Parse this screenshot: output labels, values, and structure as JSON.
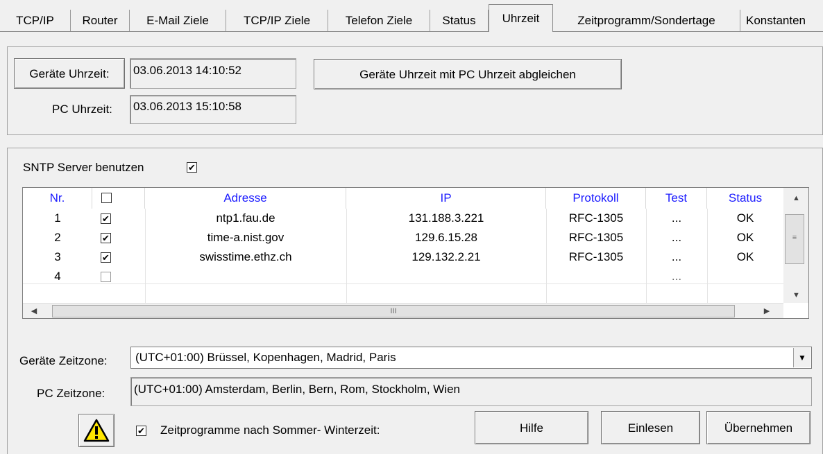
{
  "tabs": [
    {
      "label": "TCP/IP"
    },
    {
      "label": "Router"
    },
    {
      "label": "E-Mail Ziele"
    },
    {
      "label": "TCP/IP Ziele"
    },
    {
      "label": "Telefon Ziele"
    },
    {
      "label": "Status"
    },
    {
      "label": "Uhrzeit"
    },
    {
      "label": "Zeitprogramm/Sondertage"
    },
    {
      "label": "Konstanten"
    }
  ],
  "time": {
    "device_button": "Geräte Uhrzeit:",
    "device_value": "03.06.2013 14:10:52",
    "sync_button": "Geräte Uhrzeit mit PC Uhrzeit abgleichen",
    "pc_label": "PC Uhrzeit:",
    "pc_value": "03.06.2013 15:10:58"
  },
  "sntp": {
    "label": "SNTP Server benutzen",
    "checked": "✔",
    "headers": [
      "Nr.",
      "",
      "Adresse",
      "IP",
      "Protokoll",
      "Test",
      "Status"
    ],
    "rows": [
      {
        "nr": "1",
        "check": "✔",
        "address": "ntp1.fau.de",
        "ip": "131.188.3.221",
        "protocol": "RFC-1305",
        "test": "...",
        "status": "OK"
      },
      {
        "nr": "2",
        "check": "✔",
        "address": "time-a.nist.gov",
        "ip": "129.6.15.28",
        "protocol": "RFC-1305",
        "test": "...",
        "status": "OK"
      },
      {
        "nr": "3",
        "check": "✔",
        "address": "swisstime.ethz.ch",
        "ip": "129.132.2.21",
        "protocol": "RFC-1305",
        "test": "...",
        "status": "OK"
      },
      {
        "nr": "4",
        "check": "",
        "address": "",
        "ip": "",
        "protocol": "",
        "test": "...",
        "status": ""
      }
    ],
    "hscroll_grip": "III"
  },
  "timezone": {
    "device_label": "Geräte Zeitzone:",
    "device_value": "(UTC+01:00) Brüssel, Kopenhagen, Madrid, Paris",
    "pc_label": "PC Zeitzone:",
    "pc_value": "(UTC+01:00) Amsterdam, Berlin, Bern, Rom, Stockholm, Wien"
  },
  "footer": {
    "dst_checked": "✔",
    "dst_label": "Zeitprogramme nach Sommer- Winterzeit:",
    "help": "Hilfe",
    "read": "Einlesen",
    "apply": "Übernehmen"
  }
}
